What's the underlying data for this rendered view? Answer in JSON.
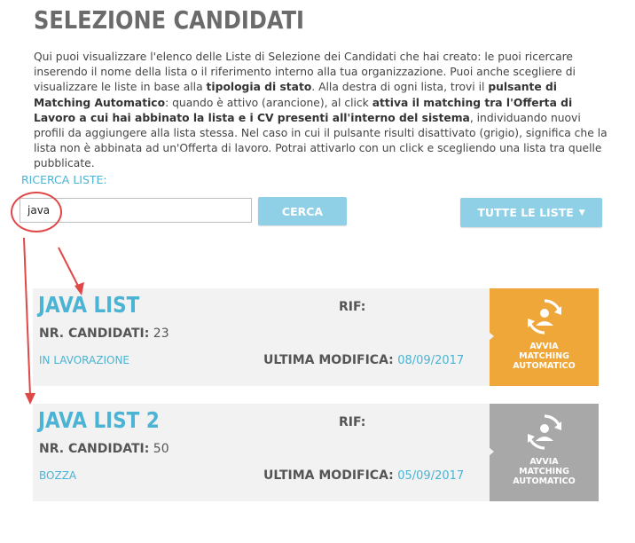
{
  "page": {
    "title": "SELEZIONE CANDIDATI",
    "intro": {
      "p1": "Qui puoi visualizzare l'elenco delle Liste di Selezione dei Candidati che hai creato: le puoi ricercare inserendo il nome della lista o il riferimento interno alla tua organizzazione. Puoi anche scegliere di visualizzare le liste in base alla ",
      "b1": "tipologia di stato",
      "p2": ". Alla destra di ogni lista, trovi il ",
      "b2": "pulsante di Matching Automatico",
      "p3": ": quando è attivo (arancione), al click ",
      "b3": "attiva il matching tra l'Offerta di Lavoro a cui hai abbinato la lista e i CV presenti all'interno del sistema",
      "p4": ", individuando nuovi profili da aggiungere alla lista stessa. Nel caso in cui il pulsante risulti disattivato (grigio), significa che la lista non è abbinata ad un'Offerta di lavoro. Potrai attivarlo con un click e scegliendo una lista tra quelle pubblicate."
    }
  },
  "search": {
    "label": "RICERCA LISTE:",
    "value": "java",
    "button": "CERCA"
  },
  "filter": {
    "label": "TUTTE LE LISTE",
    "caret": "▼"
  },
  "colors": {
    "accent": "#4bb3d3",
    "button": "#8fd0e6",
    "match_active": "#f0a73a",
    "match_inactive": "#a8a8a8",
    "annotation": "#e04848"
  },
  "lists": [
    {
      "name": "JAVA LIST",
      "count_label": "NR. CANDIDATI:",
      "count": "23",
      "status": "IN LAVORAZIONE",
      "rif_label": "RIF:",
      "modified_label": "ULTIMA MODIFICA:",
      "modified_date": "08/09/2017",
      "match_line1": "AVVIA",
      "match_line2": "MATCHING",
      "match_line3": "AUTOMATICO",
      "match_state": "active"
    },
    {
      "name": "JAVA LIST 2",
      "count_label": "NR. CANDIDATI:",
      "count": "50",
      "status": "BOZZA",
      "rif_label": "RIF:",
      "modified_label": "ULTIMA MODIFICA:",
      "modified_date": "05/09/2017",
      "match_line1": "AVVIA",
      "match_line2": "MATCHING",
      "match_line3": "AUTOMATICO",
      "match_state": "inactive"
    }
  ]
}
